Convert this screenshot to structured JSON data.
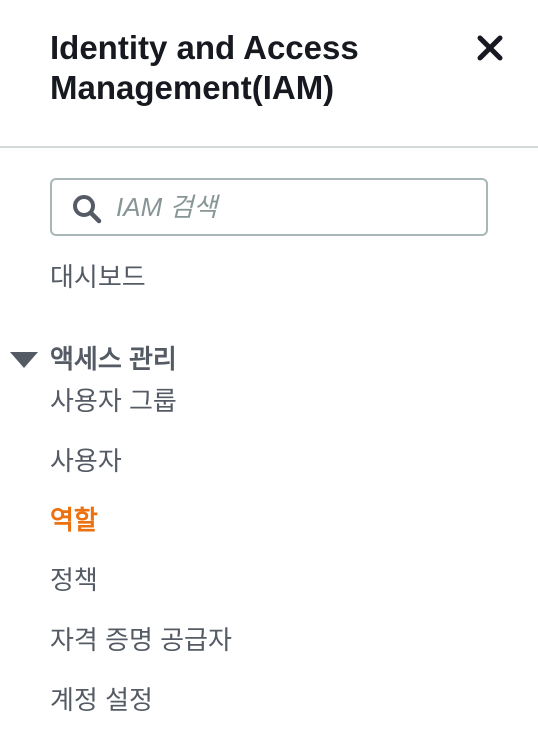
{
  "header": {
    "title_line1": "Identity and Access",
    "title_line2": "Management(IAM)"
  },
  "search": {
    "placeholder": "IAM 검색",
    "value": ""
  },
  "nav": {
    "dashboard": "대시보드",
    "section": {
      "label": "액세스 관리",
      "expanded": true,
      "items": [
        {
          "label": "사용자 그룹",
          "active": false
        },
        {
          "label": "사용자",
          "active": false
        },
        {
          "label": "역할",
          "active": true
        },
        {
          "label": "정책",
          "active": false
        },
        {
          "label": "자격 증명 공급자",
          "active": false
        },
        {
          "label": "계정 설정",
          "active": false
        }
      ]
    }
  },
  "colors": {
    "active": "#ec7211",
    "text": "#545b64",
    "title": "#16191f",
    "divider": "#d5dbdb"
  },
  "icons": {
    "close": "close-icon",
    "search": "search-icon",
    "caret": "caret-down-icon"
  }
}
